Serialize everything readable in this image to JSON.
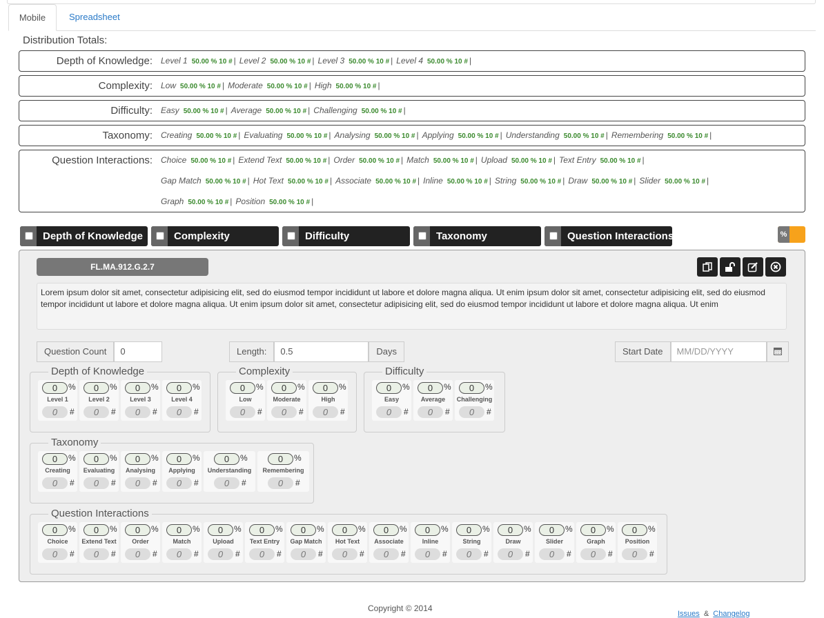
{
  "tabs": [
    {
      "label": "Mobile",
      "active": true
    },
    {
      "label": "Spreadsheet",
      "active": false
    }
  ],
  "distribution": {
    "title": "Distribution Totals:",
    "categories": [
      {
        "label": "Depth of Knowledge:",
        "rows": [
          [
            {
              "name": "Level 1",
              "value": "50.00 % 10 #"
            },
            {
              "name": "Level 2",
              "value": "50.00 % 10 #"
            },
            {
              "name": "Level 3",
              "value": "50.00 % 10 #"
            },
            {
              "name": "Level 4",
              "value": "50.00 % 10 #"
            }
          ]
        ]
      },
      {
        "label": "Complexity:",
        "rows": [
          [
            {
              "name": "Low",
              "value": "50.00 % 10 #"
            },
            {
              "name": "Moderate",
              "value": "50.00 % 10 #"
            },
            {
              "name": "High",
              "value": "50.00 % 10 #"
            }
          ]
        ]
      },
      {
        "label": "Difficulty:",
        "rows": [
          [
            {
              "name": "Easy",
              "value": "50.00 % 10 #"
            },
            {
              "name": "Average",
              "value": "50.00 % 10 #"
            },
            {
              "name": "Challenging",
              "value": "50.00 % 10 #"
            }
          ]
        ]
      },
      {
        "label": "Taxonomy:",
        "rows": [
          [
            {
              "name": "Creating",
              "value": "50.00 % 10 #"
            },
            {
              "name": "Evaluating",
              "value": "50.00 % 10 #"
            },
            {
              "name": "Analysing",
              "value": "50.00 % 10 #"
            },
            {
              "name": "Applying",
              "value": "50.00 % 10 #"
            },
            {
              "name": "Understanding",
              "value": "50.00 % 10 #"
            },
            {
              "name": "Remembering",
              "value": "50.00 % 10 #"
            }
          ]
        ]
      },
      {
        "label": "Question Interactions:",
        "rows": [
          [
            {
              "name": "Choice",
              "value": "50.00 % 10 #"
            },
            {
              "name": "Extend Text",
              "value": "50.00 % 10 #"
            },
            {
              "name": "Order",
              "value": "50.00 % 10 #"
            },
            {
              "name": "Match",
              "value": "50.00 % 10 #"
            },
            {
              "name": "Upload",
              "value": "50.00 % 10 #"
            },
            {
              "name": "Text Entry",
              "value": "50.00 % 10 #"
            }
          ],
          [
            {
              "name": "Gap Match",
              "value": "50.00 % 10 #"
            },
            {
              "name": "Hot Text",
              "value": "50.00 % 10 #"
            },
            {
              "name": "Associate",
              "value": "50.00 % 10 #"
            },
            {
              "name": "Inline",
              "value": "50.00 % 10 #"
            },
            {
              "name": "String",
              "value": "50.00 % 10 #"
            },
            {
              "name": "Draw",
              "value": "50.00 % 10 #"
            },
            {
              "name": "Slider",
              "value": "50.00 % 10 #"
            }
          ],
          [
            {
              "name": "Graph",
              "value": "50.00 % 10 #"
            },
            {
              "name": "Position",
              "value": "50.00 % 10 #"
            }
          ]
        ]
      }
    ]
  },
  "filters": [
    {
      "label": "Depth of Knowledge",
      "checked": false
    },
    {
      "label": "Complexity",
      "checked": false
    },
    {
      "label": "Difficulty",
      "checked": false
    },
    {
      "label": "Taxonomy",
      "checked": false
    },
    {
      "label": "Question Interactions",
      "checked": false
    }
  ],
  "toggle": {
    "label": "%",
    "on_color": "#f7a21b"
  },
  "standard": {
    "code": "FL.MA.912.G.2.7",
    "actions": [
      "copy-icon",
      "unlock-icon",
      "edit-icon",
      "close-circle-icon"
    ],
    "description": "Lorem ipsum dolor sit amet, consectetur adipisicing elit, sed do eiusmod tempor incididunt ut labore et dolore magna aliqua. Ut enim ipsum dolor sit amet, consectetur adipisicing elit, sed do eiusmod tempor incididunt ut labore et dolore magna aliqua. Ut enim ipsum dolor sit amet, consectetur adipisicing elit, sed do eiusmod tempor incididunt ut labore et dolore magna aliqua. Ut enim",
    "question_count": {
      "label": "Question Count",
      "value": "0"
    },
    "length": {
      "label": "Length:",
      "value": "0.5",
      "unit": "Days"
    },
    "start_date": {
      "label": "Start Date",
      "placeholder": "MM/DD/YYYY"
    }
  },
  "groups": {
    "dok": {
      "title": "Depth of Knowledge",
      "items": [
        {
          "label": "Level 1",
          "percent": "0",
          "count": "0"
        },
        {
          "label": "Level 2",
          "percent": "0",
          "count": "0"
        },
        {
          "label": "Level 3",
          "percent": "0",
          "count": "0"
        },
        {
          "label": "Level 4",
          "percent": "0",
          "count": "0"
        }
      ]
    },
    "complexity": {
      "title": "Complexity",
      "items": [
        {
          "label": "Low",
          "percent": "0",
          "count": "0"
        },
        {
          "label": "Moderate",
          "percent": "0",
          "count": "0"
        },
        {
          "label": "High",
          "percent": "0",
          "count": "0"
        }
      ]
    },
    "difficulty": {
      "title": "Difficulty",
      "items": [
        {
          "label": "Easy",
          "percent": "0",
          "count": "0"
        },
        {
          "label": "Average",
          "percent": "0",
          "count": "0"
        },
        {
          "label": "Challenging",
          "percent": "0",
          "count": "0"
        }
      ]
    },
    "taxonomy": {
      "title": "Taxonomy",
      "items": [
        {
          "label": "Creating",
          "percent": "0",
          "count": "0"
        },
        {
          "label": "Evaluating",
          "percent": "0",
          "count": "0"
        },
        {
          "label": "Analysing",
          "percent": "0",
          "count": "0"
        },
        {
          "label": "Applying",
          "percent": "0",
          "count": "0"
        },
        {
          "label": "Understanding",
          "percent": "0",
          "count": "0"
        },
        {
          "label": "Remembering",
          "percent": "0",
          "count": "0"
        }
      ]
    },
    "interactions": {
      "title": "Question Interactions",
      "items": [
        {
          "label": "Choice",
          "percent": "0",
          "count": "0"
        },
        {
          "label": "Extend Text",
          "percent": "0",
          "count": "0"
        },
        {
          "label": "Order",
          "percent": "0",
          "count": "0"
        },
        {
          "label": "Match",
          "percent": "0",
          "count": "0"
        },
        {
          "label": "Upload",
          "percent": "0",
          "count": "0"
        },
        {
          "label": "Text Entry",
          "percent": "0",
          "count": "0"
        },
        {
          "label": "Gap Match",
          "percent": "0",
          "count": "0"
        },
        {
          "label": "Hot Text",
          "percent": "0",
          "count": "0"
        },
        {
          "label": "Associate",
          "percent": "0",
          "count": "0"
        },
        {
          "label": "Inline",
          "percent": "0",
          "count": "0"
        },
        {
          "label": "String",
          "percent": "0",
          "count": "0"
        },
        {
          "label": "Draw",
          "percent": "0",
          "count": "0"
        },
        {
          "label": "Slider",
          "percent": "0",
          "count": "0"
        },
        {
          "label": "Graph",
          "percent": "0",
          "count": "0"
        },
        {
          "label": "Position",
          "percent": "0",
          "count": "0"
        }
      ]
    }
  },
  "cell_symbols": {
    "percent": "%",
    "count": "#"
  },
  "footer": {
    "copyright": "Copyright © 2014",
    "links": [
      "Issues",
      "&",
      "Changelog"
    ]
  }
}
